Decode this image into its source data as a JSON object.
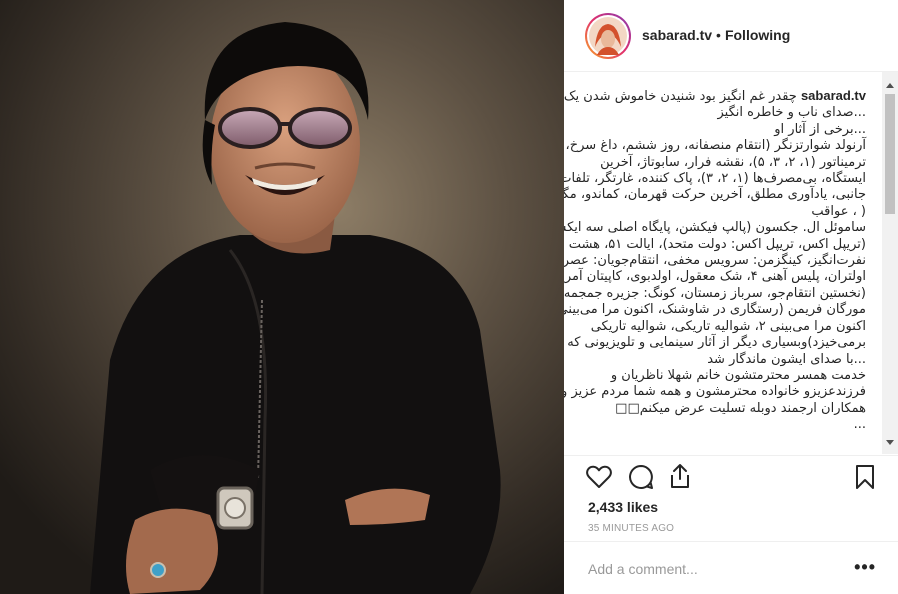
{
  "post": {
    "username": "sabarad.tv",
    "follow_status": "Following",
    "separator": "•",
    "caption_username": "sabarad.tv",
    "caption_lines": [
      "چقدر غم انگیز بود شنیدن خاموش شدن یک",
      "...صدای ناب و خاطره انگیز",
      "...برخی از آثار او",
      "آرنولد شوارتزنگر (انتقام منصفانه، روز ششم، داغ سرخ،",
      "ترمیناتور (۱، ۲، ۳، ۵)، نقشه فرار، سابوتاژ، آخرین",
      "ایستگاه، بی‌مصرف‌ها (۱، ۲، ۳)، پاک کننده، غارتگر، تلفات",
      "جانبی، یادآوری مطلق، آخرین حرکت قهرمان، کماندو، مگی",
      "( ، عواقب",
      "ساموئل ال. جکسون (پالپ فیکشن، پایگاه اصلی سه ایکس",
      "(تریپل اکس، تریپل اکس: دولت متحد)، ایالت ۵۱، هشت",
      "نفرت‌انگیز، کینگزمن: سرویس مخفی، انتقام‌جویان: عصر",
      "اولتران، پلیس آهنی ۴، شک معقول، اولدبوی، کاپیتان آمریکا",
      "(نخستین انتقام‌جو، سرباز زمستان، کونگ: جزیره جمجمه",
      "مورگان فریمن (رستگاری در شاوشنک، اکنون مرا می‌بینی،",
      "اکنون مرا می‌بینی ۲، شوالیه تاریکی، شوالیه تاریکی",
      "برمی‌خیزد)وبسیاری دیگر از آثار سینمایی و تلویزیونی که",
      "...با صدای ایشون ماندگار شد",
      "خدمت همسر محترمتشون خانم شهلا ناظریان و",
      "فرزندعزیزو خانواده محترمشون و همه شما مردم عزیز و",
      "همکاران ارجمند دوبله تسلیت عرض میکنم□□",
      "..."
    ],
    "likes": "2,433 likes",
    "timestamp": "35 MINUTES AGO",
    "comment_placeholder": "Add a comment...",
    "more_label": "•••"
  },
  "colors": {
    "accent_ring_start": "#f9a825",
    "accent_ring_end": "#833ab4",
    "text_primary": "#262626",
    "text_secondary": "#999999",
    "divider": "#efefef"
  },
  "icons": {
    "like": "heart-icon",
    "comment": "speech-bubble-icon",
    "share": "share-icon",
    "save": "bookmark-icon"
  }
}
